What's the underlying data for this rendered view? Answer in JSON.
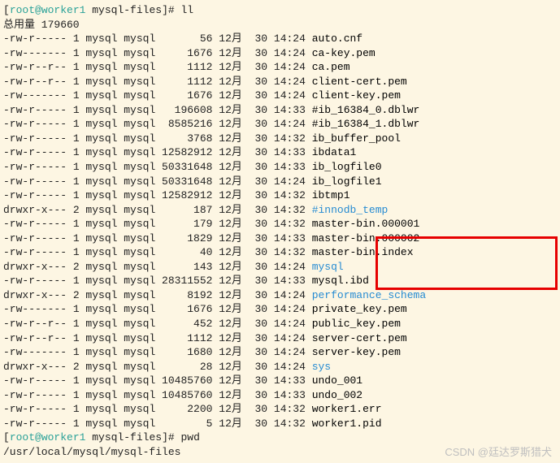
{
  "prompt1": {
    "lbracket": "[",
    "user": "root@worker1",
    "path": " mysql-files",
    "rbracket": "]# ",
    "cmd": "ll"
  },
  "total": "总用量 179660",
  "rows": [
    {
      "perm": "-rw-r-----",
      "links": "1",
      "owner": "mysql",
      "group": "mysql",
      "size": "56",
      "month": "12月",
      "day": "30",
      "time": "14:24",
      "name": "auto.cnf",
      "type": "f"
    },
    {
      "perm": "-rw-------",
      "links": "1",
      "owner": "mysql",
      "group": "mysql",
      "size": "1676",
      "month": "12月",
      "day": "30",
      "time": "14:24",
      "name": "ca-key.pem",
      "type": "f"
    },
    {
      "perm": "-rw-r--r--",
      "links": "1",
      "owner": "mysql",
      "group": "mysql",
      "size": "1112",
      "month": "12月",
      "day": "30",
      "time": "14:24",
      "name": "ca.pem",
      "type": "f"
    },
    {
      "perm": "-rw-r--r--",
      "links": "1",
      "owner": "mysql",
      "group": "mysql",
      "size": "1112",
      "month": "12月",
      "day": "30",
      "time": "14:24",
      "name": "client-cert.pem",
      "type": "f"
    },
    {
      "perm": "-rw-------",
      "links": "1",
      "owner": "mysql",
      "group": "mysql",
      "size": "1676",
      "month": "12月",
      "day": "30",
      "time": "14:24",
      "name": "client-key.pem",
      "type": "f"
    },
    {
      "perm": "-rw-r-----",
      "links": "1",
      "owner": "mysql",
      "group": "mysql",
      "size": "196608",
      "month": "12月",
      "day": "30",
      "time": "14:33",
      "name": "#ib_16384_0.dblwr",
      "type": "f"
    },
    {
      "perm": "-rw-r-----",
      "links": "1",
      "owner": "mysql",
      "group": "mysql",
      "size": "8585216",
      "month": "12月",
      "day": "30",
      "time": "14:24",
      "name": "#ib_16384_1.dblwr",
      "type": "f"
    },
    {
      "perm": "-rw-r-----",
      "links": "1",
      "owner": "mysql",
      "group": "mysql",
      "size": "3768",
      "month": "12月",
      "day": "30",
      "time": "14:32",
      "name": "ib_buffer_pool",
      "type": "f"
    },
    {
      "perm": "-rw-r-----",
      "links": "1",
      "owner": "mysql",
      "group": "mysql",
      "size": "12582912",
      "month": "12月",
      "day": "30",
      "time": "14:33",
      "name": "ibdata1",
      "type": "f"
    },
    {
      "perm": "-rw-r-----",
      "links": "1",
      "owner": "mysql",
      "group": "mysql",
      "size": "50331648",
      "month": "12月",
      "day": "30",
      "time": "14:33",
      "name": "ib_logfile0",
      "type": "f"
    },
    {
      "perm": "-rw-r-----",
      "links": "1",
      "owner": "mysql",
      "group": "mysql",
      "size": "50331648",
      "month": "12月",
      "day": "30",
      "time": "14:24",
      "name": "ib_logfile1",
      "type": "f"
    },
    {
      "perm": "-rw-r-----",
      "links": "1",
      "owner": "mysql",
      "group": "mysql",
      "size": "12582912",
      "month": "12月",
      "day": "30",
      "time": "14:32",
      "name": "ibtmp1",
      "type": "f"
    },
    {
      "perm": "drwxr-x---",
      "links": "2",
      "owner": "mysql",
      "group": "mysql",
      "size": "187",
      "month": "12月",
      "day": "30",
      "time": "14:32",
      "name": "#innodb_temp",
      "type": "d"
    },
    {
      "perm": "-rw-r-----",
      "links": "1",
      "owner": "mysql",
      "group": "mysql",
      "size": "179",
      "month": "12月",
      "day": "30",
      "time": "14:32",
      "name": "master-bin.000001",
      "type": "f"
    },
    {
      "perm": "-rw-r-----",
      "links": "1",
      "owner": "mysql",
      "group": "mysql",
      "size": "1829",
      "month": "12月",
      "day": "30",
      "time": "14:33",
      "name": "master-bin.000002",
      "type": "f"
    },
    {
      "perm": "-rw-r-----",
      "links": "1",
      "owner": "mysql",
      "group": "mysql",
      "size": "40",
      "month": "12月",
      "day": "30",
      "time": "14:32",
      "name": "master-bin.index",
      "type": "f"
    },
    {
      "perm": "drwxr-x---",
      "links": "2",
      "owner": "mysql",
      "group": "mysql",
      "size": "143",
      "month": "12月",
      "day": "30",
      "time": "14:24",
      "name": "mysql",
      "type": "d"
    },
    {
      "perm": "-rw-r-----",
      "links": "1",
      "owner": "mysql",
      "group": "mysql",
      "size": "28311552",
      "month": "12月",
      "day": "30",
      "time": "14:33",
      "name": "mysql.ibd",
      "type": "f"
    },
    {
      "perm": "drwxr-x---",
      "links": "2",
      "owner": "mysql",
      "group": "mysql",
      "size": "8192",
      "month": "12月",
      "day": "30",
      "time": "14:24",
      "name": "performance_schema",
      "type": "d"
    },
    {
      "perm": "-rw-------",
      "links": "1",
      "owner": "mysql",
      "group": "mysql",
      "size": "1676",
      "month": "12月",
      "day": "30",
      "time": "14:24",
      "name": "private_key.pem",
      "type": "f"
    },
    {
      "perm": "-rw-r--r--",
      "links": "1",
      "owner": "mysql",
      "group": "mysql",
      "size": "452",
      "month": "12月",
      "day": "30",
      "time": "14:24",
      "name": "public_key.pem",
      "type": "f"
    },
    {
      "perm": "-rw-r--r--",
      "links": "1",
      "owner": "mysql",
      "group": "mysql",
      "size": "1112",
      "month": "12月",
      "day": "30",
      "time": "14:24",
      "name": "server-cert.pem",
      "type": "f"
    },
    {
      "perm": "-rw-------",
      "links": "1",
      "owner": "mysql",
      "group": "mysql",
      "size": "1680",
      "month": "12月",
      "day": "30",
      "time": "14:24",
      "name": "server-key.pem",
      "type": "f"
    },
    {
      "perm": "drwxr-x---",
      "links": "2",
      "owner": "mysql",
      "group": "mysql",
      "size": "28",
      "month": "12月",
      "day": "30",
      "time": "14:24",
      "name": "sys",
      "type": "d"
    },
    {
      "perm": "-rw-r-----",
      "links": "1",
      "owner": "mysql",
      "group": "mysql",
      "size": "10485760",
      "month": "12月",
      "day": "30",
      "time": "14:33",
      "name": "undo_001",
      "type": "f"
    },
    {
      "perm": "-rw-r-----",
      "links": "1",
      "owner": "mysql",
      "group": "mysql",
      "size": "10485760",
      "month": "12月",
      "day": "30",
      "time": "14:33",
      "name": "undo_002",
      "type": "f"
    },
    {
      "perm": "-rw-r-----",
      "links": "1",
      "owner": "mysql",
      "group": "mysql",
      "size": "2200",
      "month": "12月",
      "day": "30",
      "time": "14:32",
      "name": "worker1.err",
      "type": "f"
    },
    {
      "perm": "-rw-r-----",
      "links": "1",
      "owner": "mysql",
      "group": "mysql",
      "size": "5",
      "month": "12月",
      "day": "30",
      "time": "14:32",
      "name": "worker1.pid",
      "type": "f"
    }
  ],
  "prompt2": {
    "lbracket": "[",
    "user": "root@worker1",
    "path": " mysql-files",
    "rbracket": "]# ",
    "cmd": "pwd"
  },
  "pwd_output": "/usr/local/mysql/mysql-files",
  "watermark": "CSDN @廷达罗斯猎犬"
}
